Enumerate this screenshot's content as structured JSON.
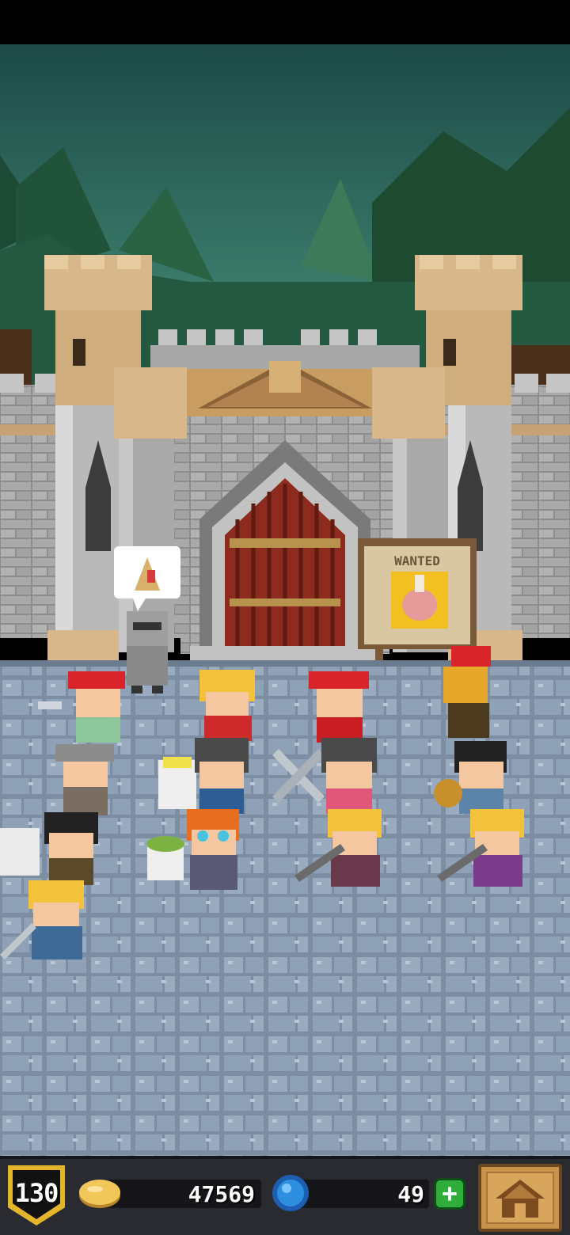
{
  "colors": {
    "sky_top": "#1d4a47",
    "sky_bottom": "#4d9a80",
    "stone_wall": "#9a9a9a",
    "tower_sand": "#d8b88a",
    "door_red": "#8c2b1e",
    "cobblestone": "#8294a8",
    "hud_bg": "#2a2a31",
    "level_gold": "#e4b52a",
    "coin_gold": "#f1c75a",
    "gem_blue": "#2e8fe0",
    "plus_green": "#2fae3b"
  },
  "scene": {
    "type": "castle-courtyard",
    "wanted_board": {
      "label": "WANTED",
      "icon": "meat-icon"
    },
    "quest_bubble": {
      "icon": "quest-scroll-icon"
    }
  },
  "hud": {
    "level": "130",
    "coins": "47569",
    "gems": "49",
    "plus_label": "+",
    "home_icon": "home-icon"
  }
}
